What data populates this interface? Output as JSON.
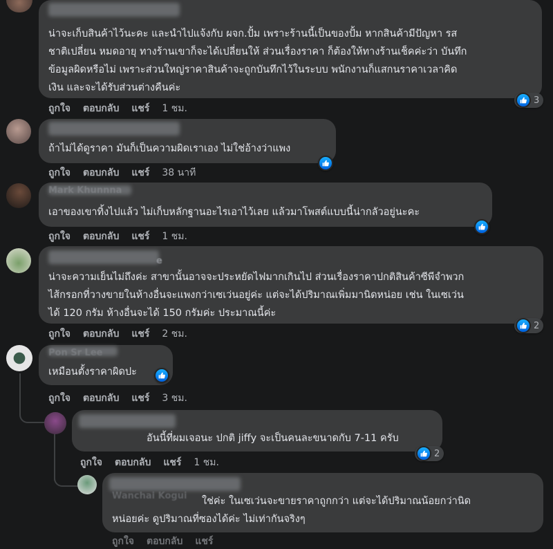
{
  "actions": {
    "like": "ถูกใจ",
    "reply": "ตอบกลับ",
    "share": "แชร์"
  },
  "icons": {
    "reaction": "like-icon"
  },
  "colors": {
    "background": "#18191a",
    "bubble": "#3a3b3c",
    "like_blue": "#1877f2"
  },
  "comments": [
    {
      "text": "น่าจะเก็บสินค้าไว้นะคะ และนำไปแจ้งกับ ผจก.ปั้ม เพราะร้านนี้เป็นของปั้ม หากสินค้ามีปัญหา รส\nชาติเปลี่ยน หมดอายุ ทางร้านเขาก็จะได้เปลี่ยนให้ ส่วนเรื่องราคา ก็ต้องให้ทางร้านเช็คค่ะว่า บันทึก\nข้อมูลผิดหรือไม่ เพราะส่วนใหญ่ราคาสินค้าจะถูกบันทึกไว้ในระบบ พนักงานก็แสกนราคาเวลาคิด\nเงิน และจะได้รับส่วนต่างคืนค่ะ",
      "time": "1 ชม.",
      "reactions": "3"
    },
    {
      "text": "ถ้าไม่ได้ดูราคา มันก็เป็นความผิดเราเอง ไม่ใช่อ้างว่าแพง",
      "time": "38 นาที",
      "reactions": ""
    },
    {
      "author": "Mark Khunnna",
      "text": "เอาของเขาทิ้งไปแล้ว ไม่เก็บหลักฐานอะไรเอาไว้เลย แล้วมาโพสต์แบบนี้น่ากลัวอยู่นะคะ",
      "time": "1 ชม.",
      "reactions": ""
    },
    {
      "author_suffix": "e",
      "text": "น่าจะความเย็นไม่ถึงค่ะ สาขานั้นอาจจะประหยัดไฟมากเกินไป ส่วนเรื่องราคาปกติสินค้าซีพีจำพวก\nไส้กรอกที่วางขายในห้างอื่นจะแพงกว่าเซเว่นอยู่ค่ะ แต่จะได้ปริมาณเพิ่มมานิดหน่อย เช่น ในเซเว่น\nได้ 120 กรัม ห้างอื่นจะได้ 150 กรัมค่ะ ประมาณนี้ค่ะ",
      "time": "2 ชม.",
      "reactions": "2"
    },
    {
      "author": "Pon Sr Lee",
      "text": "เหมือนตั้งราคาผิดปะ",
      "time": "3 ชม.",
      "reactions": ""
    },
    {
      "text": "อันนี้ที่ผมเจอนะ ปกติ jiffy จะเป็นคนละขนาดกับ 7-11 ครับ",
      "time": "1 ชม.",
      "reactions": "2"
    },
    {
      "author": "Wanchai Kogui",
      "text": "ใช่ค่ะ ในเซเว่นจะขายราคาถูกกว่า แต่จะได้ปริมาณน้อยกว่านิด\nหน่อยค่ะ ดูปริมาณที่ซองได้ค่ะ ไม่เท่ากันจริงๆ",
      "time": "",
      "reactions": ""
    }
  ]
}
